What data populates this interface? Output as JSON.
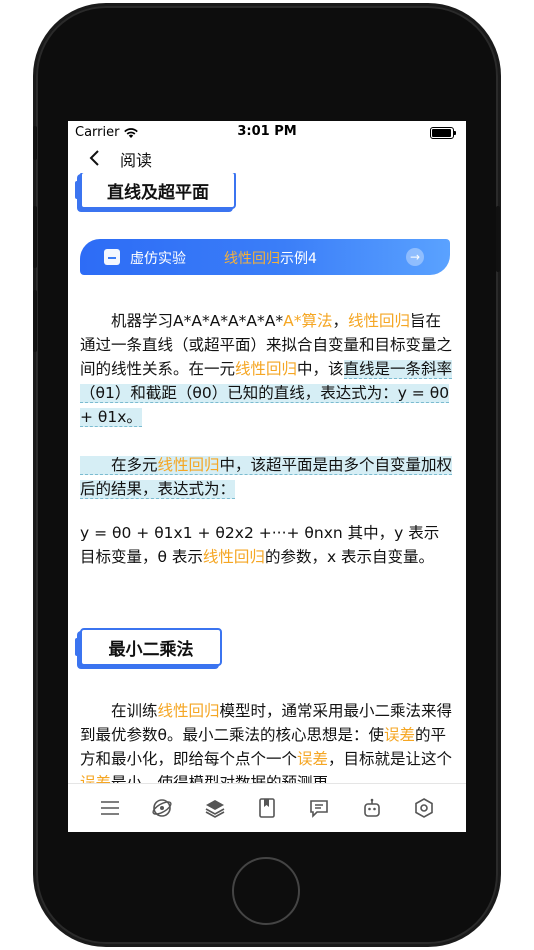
{
  "status": {
    "carrier": "Carrier",
    "time": "3:01 PM"
  },
  "nav": {
    "title": "阅读"
  },
  "sections": {
    "s1_title": "直线及超平面",
    "s2_title": "最小二乘法"
  },
  "banner": {
    "label": "虚仿实验",
    "link_highlight": "线性回归",
    "link_rest": "示例4"
  },
  "p1": {
    "a": "机器学习A*A*A*A*A*A*",
    "b": "A*算法",
    "c": "，",
    "d": "线性回归",
    "e": "旨在通过一条直线（或超平面）来拟合自变量和目标变量之间的线性关系。在一元",
    "f": "线性回归",
    "g": "中，该",
    "h": "直线是一条斜率（θ1）和截距（θ0）已知的直线，表达式为：y = θ0 + θ1x。"
  },
  "p2": {
    "a": "在多元",
    "b": "线性回归",
    "c": "中，该超平面是由多个自变量加权后的结果，表达式为："
  },
  "p3": {
    "a": "y = θ0 + θ1x1 + θ2x2 +···+ θnxn 其中，y 表示目标变量，θ 表示",
    "b": "线性回归",
    "c": "的参数，x 表示自变量。"
  },
  "p4": {
    "a": "在训练",
    "b": "线性回归",
    "c": "模型时，通常采用最小二乘法来得到最优参数θ。最小二乘法的核心思想是：使",
    "d": "误差",
    "e": "的平方和最小化，即给每个点个一个",
    "f": "误差",
    "g": "，目标就是让这个",
    "h": "误差",
    "i": "最小，使得模型对数据的预测更"
  },
  "tabs": [
    "menu-icon",
    "explore-icon",
    "layers-icon",
    "book-icon",
    "chat-icon",
    "robot-icon",
    "settings-icon"
  ],
  "colors": {
    "accent": "#3b74f0",
    "highlight_text": "#f5a623",
    "highlight_bg": "#d6eef5"
  }
}
